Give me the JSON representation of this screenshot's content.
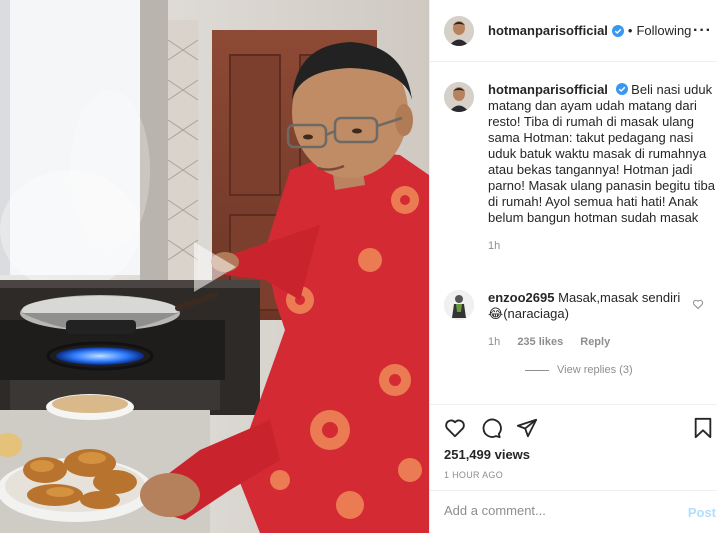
{
  "header": {
    "username": "hotmanparisofficial",
    "separator": "•",
    "follow_status": "Following",
    "more_icon": "more-options-icon"
  },
  "caption": {
    "username": "hotmanparisofficial",
    "text": "Beli nasi uduk matang dan ayam udah matang dari resto! Tiba di rumah di masak ulang sama Hotman: takut pedagang nasi uduk batuk waktu masak di rumahnya atau bekas tangannya! Hotman jadi parno! Masak ulang panasin begitu tiba di rumah! Ayol semua hati hati! Anak belum bangun hotman sudah masak",
    "time": "1h"
  },
  "comment": {
    "username": "enzoo2695",
    "text_line1": "Masak,masak sendiri",
    "emoji": "😂",
    "text_line2": "(naraciaga)",
    "time": "1h",
    "likes": "235 likes",
    "reply": "Reply"
  },
  "view_replies": "View replies (3)",
  "actions": {
    "views": "251,499 views",
    "time_ago": "1 HOUR AGO"
  },
  "add_comment": {
    "placeholder": "Add a comment...",
    "post_label": "Post"
  },
  "colors": {
    "verified": "#3897f0",
    "post_disabled": "#b2dffc",
    "muted": "#8e8e8e",
    "robe": "#d42a33",
    "flame": "#2f7bff"
  }
}
